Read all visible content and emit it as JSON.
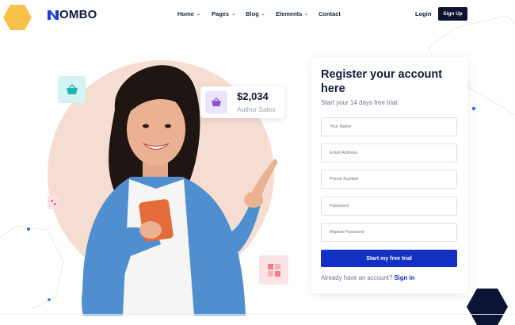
{
  "header": {
    "logo_text": "OMBO",
    "nav": [
      {
        "label": "Home",
        "has_dropdown": true
      },
      {
        "label": "Pages",
        "has_dropdown": true
      },
      {
        "label": "Blog",
        "has_dropdown": true
      },
      {
        "label": "Elements",
        "has_dropdown": true
      },
      {
        "label": "Contact",
        "has_dropdown": false
      }
    ],
    "login_label": "Login",
    "signup_label": "Sign Up"
  },
  "hero": {
    "sales_amount": "$2,034",
    "sales_label": "Author Sales",
    "icons": [
      "shopping-basket-icon",
      "grid-squares-icon"
    ]
  },
  "register": {
    "title": "Register your account here",
    "subtitle": "Start your 14 days free trial.",
    "fields": [
      {
        "placeholder": "Your Name"
      },
      {
        "placeholder": "Email Address"
      },
      {
        "placeholder": "Phone Number"
      },
      {
        "placeholder": "Password"
      },
      {
        "placeholder": "Repeat Password"
      }
    ],
    "submit_label": "Start my free trial",
    "signin_prompt": "Already have an account?",
    "signin_link": "Sign in"
  },
  "colors": {
    "brand_navy": "#0d1330",
    "primary_blue": "#1330c4",
    "accent_yellow": "#f8c14a",
    "peach": "#f6ddd1"
  }
}
